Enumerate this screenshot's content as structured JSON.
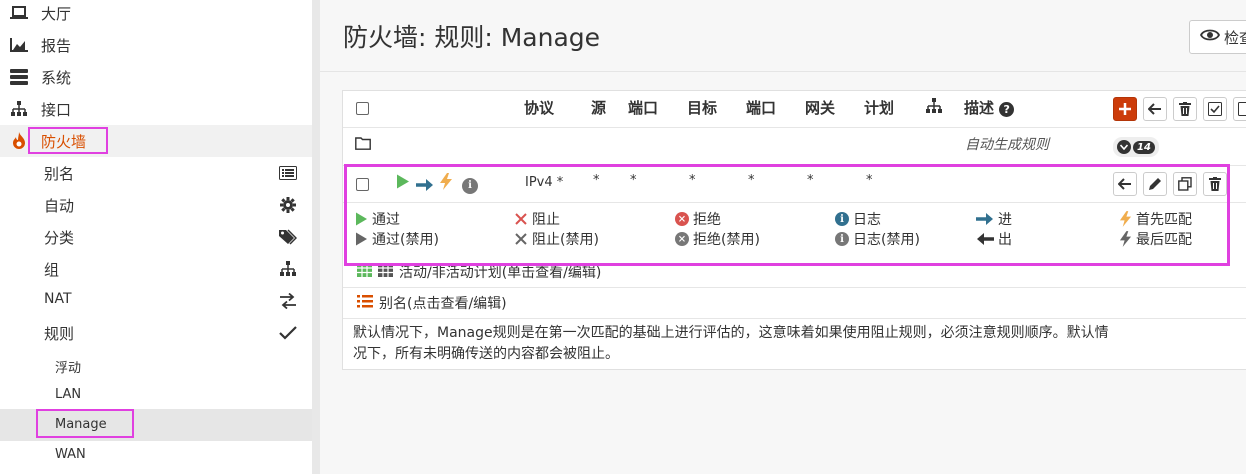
{
  "sidebar": {
    "items": [
      {
        "label": "大厅",
        "icon": "laptop-icon"
      },
      {
        "label": "报告",
        "icon": "chart-icon"
      },
      {
        "label": "系统",
        "icon": "server-icon"
      },
      {
        "label": "接口",
        "icon": "sitemap-icon"
      },
      {
        "label": "防火墙",
        "icon": "fire-icon"
      }
    ],
    "firewall_sub": [
      {
        "label": "别名",
        "icon": "list-icon"
      },
      {
        "label": "自动",
        "icon": "gear-icon"
      },
      {
        "label": "分类",
        "icon": "tags-icon"
      },
      {
        "label": "组",
        "icon": "sitemap-icon"
      },
      {
        "label": "NAT",
        "icon": "exchange-icon"
      },
      {
        "label": "规则",
        "icon": "check-icon"
      }
    ],
    "rules_sub": [
      {
        "label": "浮动"
      },
      {
        "label": "LAN"
      },
      {
        "label": "Manage"
      },
      {
        "label": "WAN"
      }
    ]
  },
  "header": {
    "title": "防火墙: 规则: Manage",
    "inspect_label": "检查"
  },
  "table": {
    "columns": [
      "协议",
      "源",
      "端口",
      "目标",
      "端口",
      "网关",
      "计划",
      "描述"
    ],
    "auto_row": {
      "description": "自动生成规则",
      "count": "14"
    },
    "rule_row": {
      "protocol": "IPv4 *",
      "source": "*",
      "source_port": "*",
      "destination": "*",
      "dest_port": "*",
      "gateway": "*",
      "schedule": "*"
    }
  },
  "legend": [
    {
      "label": "通过",
      "icon": "pass-icon"
    },
    {
      "label": "阻止",
      "icon": "block-icon"
    },
    {
      "label": "拒绝",
      "icon": "reject-icon"
    },
    {
      "label": "日志",
      "icon": "log-icon"
    },
    {
      "label": "进",
      "icon": "in-arrow-icon"
    },
    {
      "label": "首先匹配",
      "icon": "first-match-icon"
    },
    {
      "label": "通过(禁用)",
      "icon": "pass-disabled-icon"
    },
    {
      "label": "阻止(禁用)",
      "icon": "block-disabled-icon"
    },
    {
      "label": "拒绝(禁用)",
      "icon": "reject-disabled-icon"
    },
    {
      "label": "日志(禁用)",
      "icon": "log-disabled-icon"
    },
    {
      "label": "出",
      "icon": "out-arrow-icon"
    },
    {
      "label": "最后匹配",
      "icon": "last-match-icon"
    }
  ],
  "info": {
    "schedule_text": "活动/非活动计划(单击查看/编辑)",
    "alias_text": "别名(点击查看/编辑)",
    "note_line1": "默认情况下，Manage规则是在第一次匹配的基础上进行评估的，这意味着如果使用阻止规则，必须注意规则顺序。默认情",
    "note_line2": "况下，所有未明确传送的内容都会被阻止。"
  },
  "colors": {
    "accent": "#d94f00",
    "pass": "#5cb85c",
    "block": "#d9534f",
    "log": "#31708f",
    "highlight": "#e040e0"
  }
}
